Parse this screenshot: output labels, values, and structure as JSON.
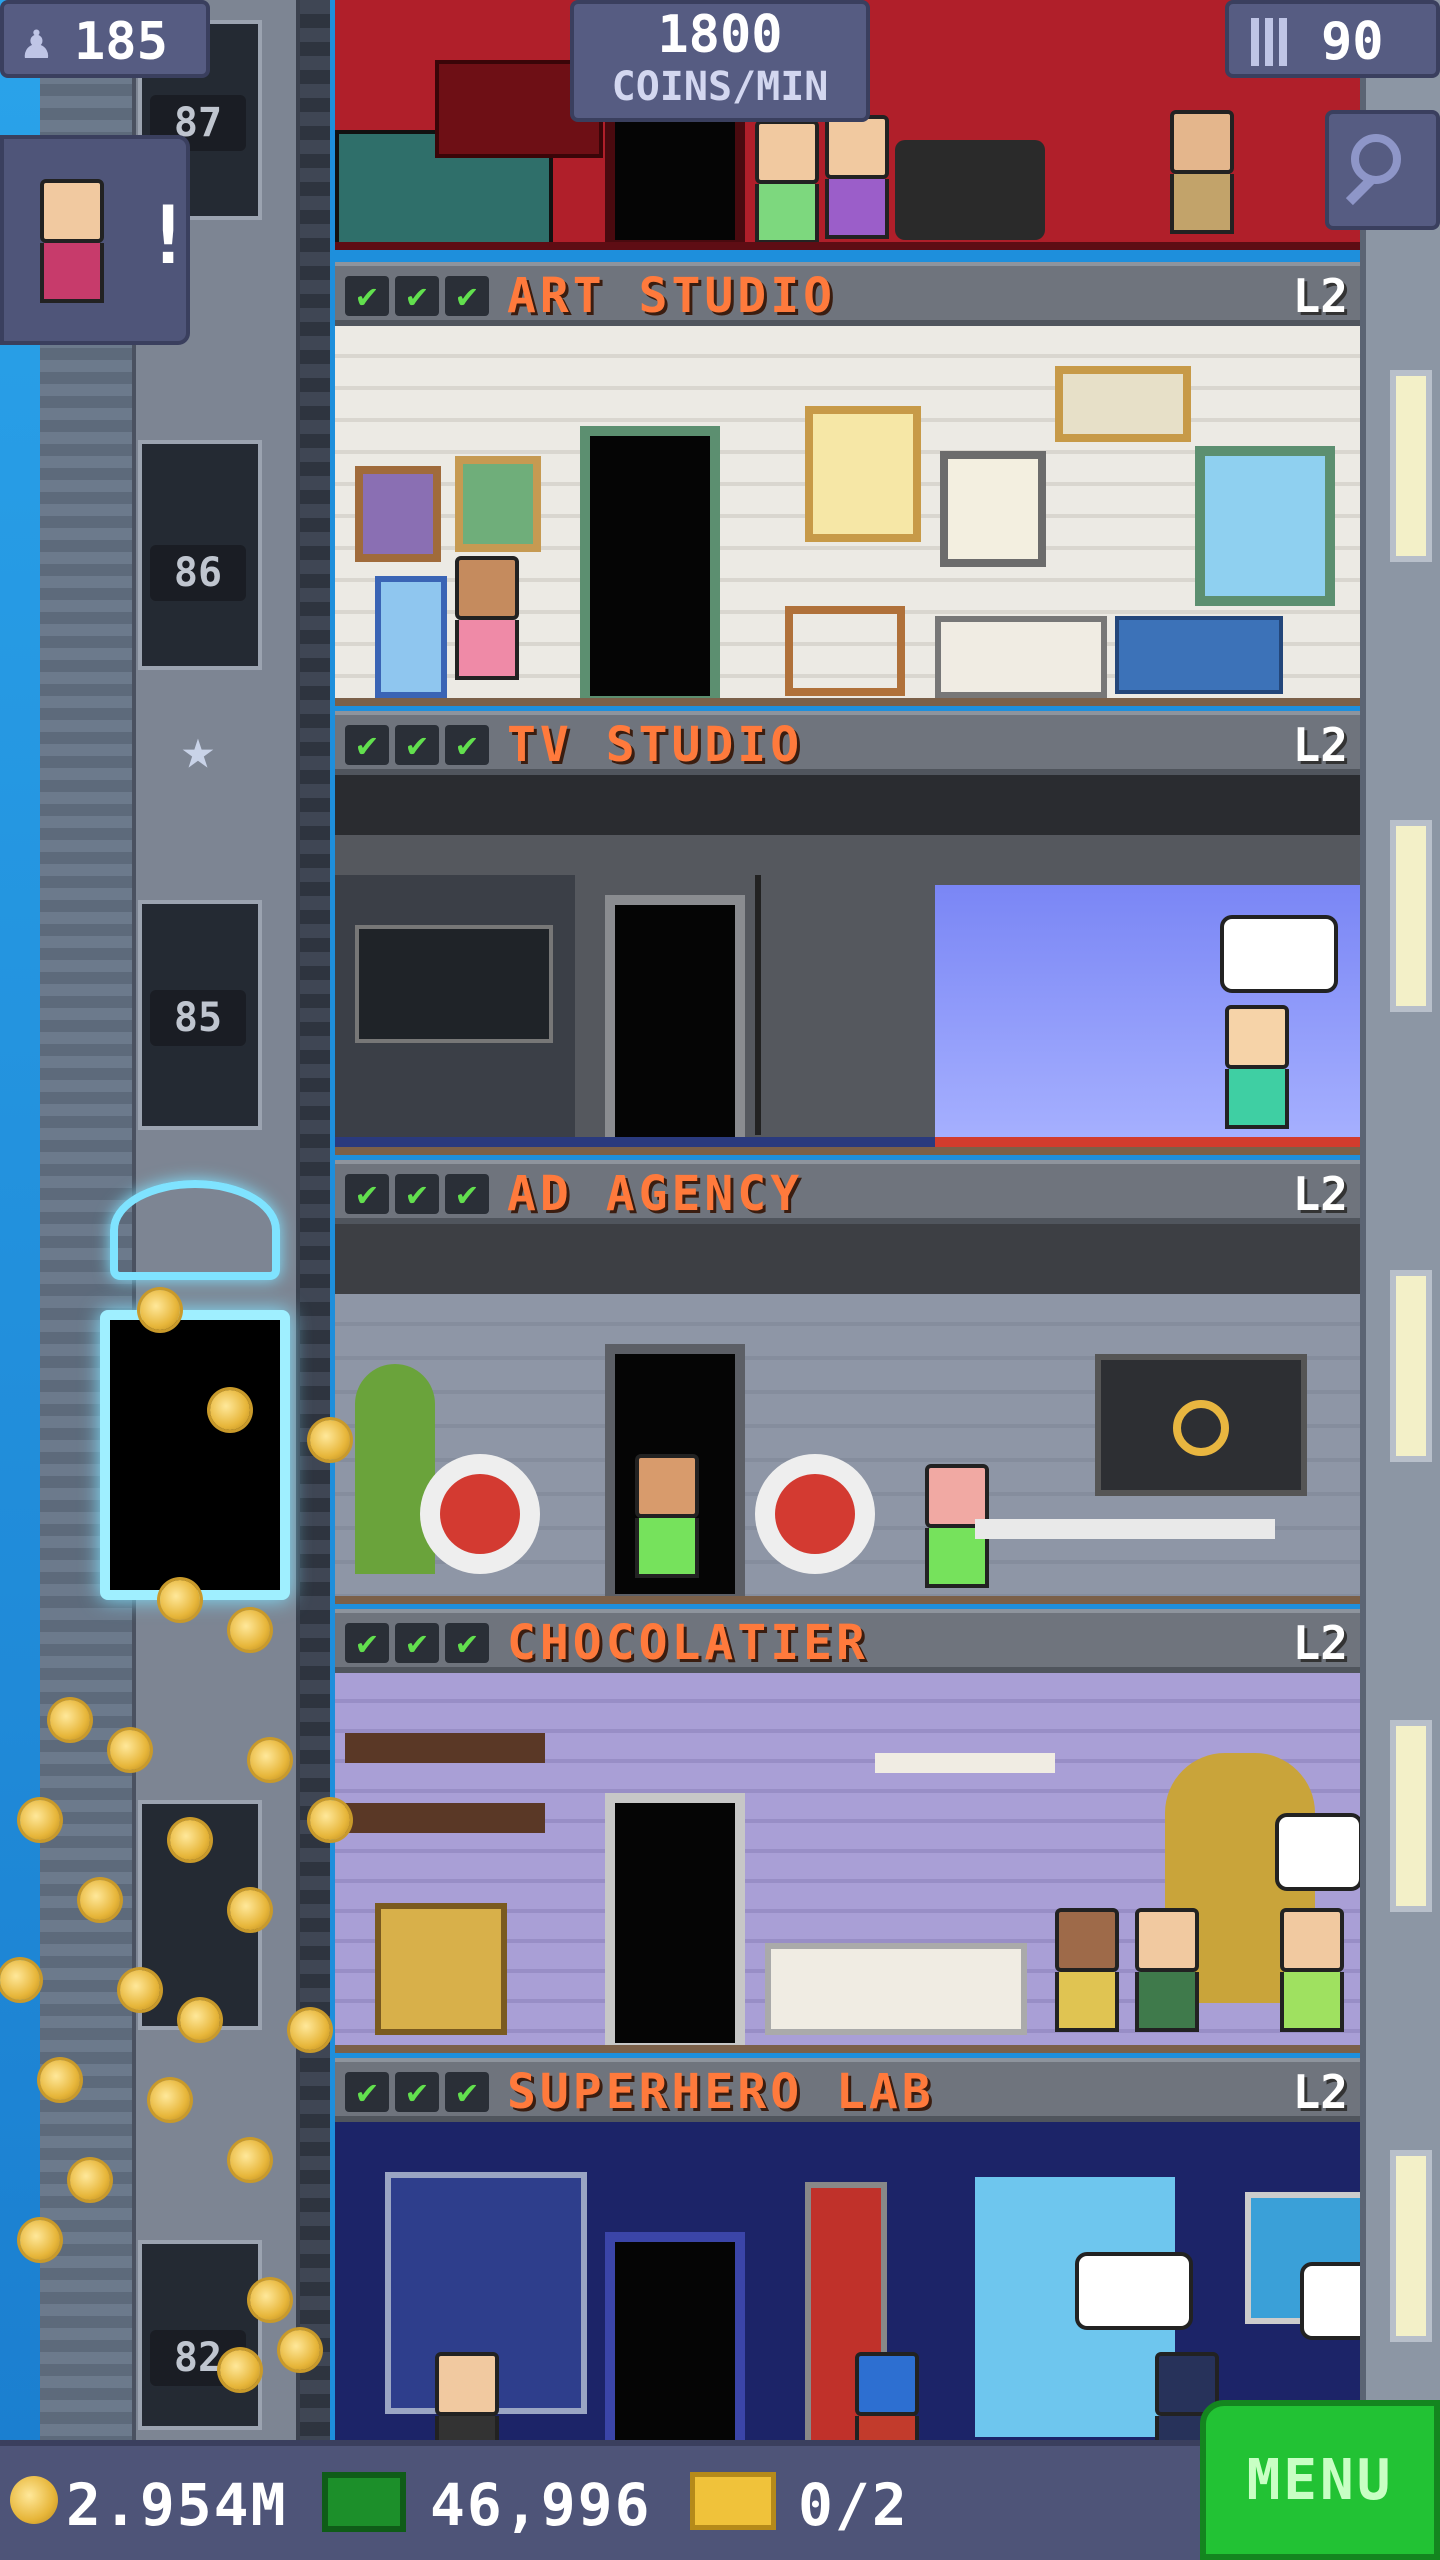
{
  "hud": {
    "population": "185",
    "coins_rate_value": "1800",
    "coins_rate_unit": "COINS/MIN",
    "floors_count": "90",
    "population_icon": "person-icon",
    "floors_icon": "building-icon",
    "search_icon": "magnifier-icon",
    "notification_mark": "!"
  },
  "shaft": {
    "floor_numbers": [
      "87",
      "86",
      "85",
      "82"
    ]
  },
  "floors": [
    {
      "name": "ART STUDIO",
      "level": "L2",
      "checks": [
        "✔",
        "✔",
        "✔"
      ]
    },
    {
      "name": "TV STUDIO",
      "level": "L2",
      "checks": [
        "✔",
        "✔",
        "✔"
      ]
    },
    {
      "name": "AD AGENCY",
      "level": "L2",
      "checks": [
        "✔",
        "✔",
        "✔"
      ]
    },
    {
      "name": "CHOCOLATIER",
      "level": "L2",
      "checks": [
        "✔",
        "✔",
        "✔"
      ]
    },
    {
      "name": "SUPERHERO LAB",
      "level": "L2",
      "checks": [
        "✔",
        "✔",
        "✔"
      ]
    }
  ],
  "bottom": {
    "coins": "2.954M",
    "bux": "46,996",
    "tickets": "0/2",
    "menu_label": "MENU"
  },
  "colors": {
    "floor_name": "#ff7a3c",
    "check": "#62e04e",
    "menu_button": "#22c234",
    "hud": "#565c82"
  }
}
